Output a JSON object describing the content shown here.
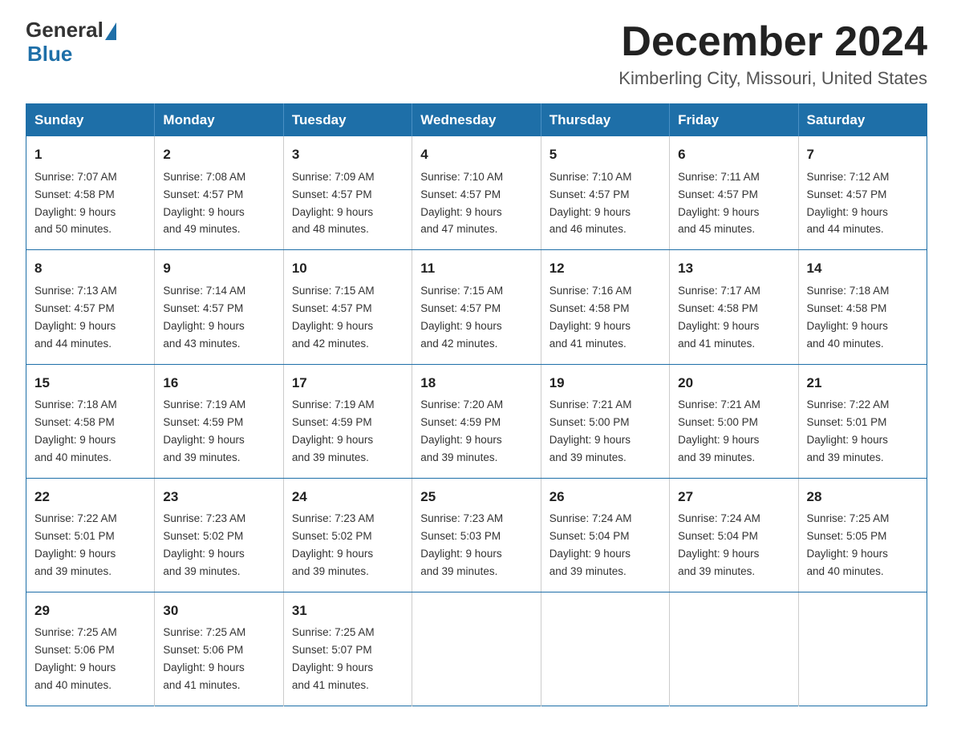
{
  "logo": {
    "general": "General",
    "blue": "Blue"
  },
  "title": "December 2024",
  "location": "Kimberling City, Missouri, United States",
  "days_of_week": [
    "Sunday",
    "Monday",
    "Tuesday",
    "Wednesday",
    "Thursday",
    "Friday",
    "Saturday"
  ],
  "weeks": [
    [
      {
        "day": "1",
        "sunrise": "7:07 AM",
        "sunset": "4:58 PM",
        "daylight": "9 hours and 50 minutes."
      },
      {
        "day": "2",
        "sunrise": "7:08 AM",
        "sunset": "4:57 PM",
        "daylight": "9 hours and 49 minutes."
      },
      {
        "day": "3",
        "sunrise": "7:09 AM",
        "sunset": "4:57 PM",
        "daylight": "9 hours and 48 minutes."
      },
      {
        "day": "4",
        "sunrise": "7:10 AM",
        "sunset": "4:57 PM",
        "daylight": "9 hours and 47 minutes."
      },
      {
        "day": "5",
        "sunrise": "7:10 AM",
        "sunset": "4:57 PM",
        "daylight": "9 hours and 46 minutes."
      },
      {
        "day": "6",
        "sunrise": "7:11 AM",
        "sunset": "4:57 PM",
        "daylight": "9 hours and 45 minutes."
      },
      {
        "day": "7",
        "sunrise": "7:12 AM",
        "sunset": "4:57 PM",
        "daylight": "9 hours and 44 minutes."
      }
    ],
    [
      {
        "day": "8",
        "sunrise": "7:13 AM",
        "sunset": "4:57 PM",
        "daylight": "9 hours and 44 minutes."
      },
      {
        "day": "9",
        "sunrise": "7:14 AM",
        "sunset": "4:57 PM",
        "daylight": "9 hours and 43 minutes."
      },
      {
        "day": "10",
        "sunrise": "7:15 AM",
        "sunset": "4:57 PM",
        "daylight": "9 hours and 42 minutes."
      },
      {
        "day": "11",
        "sunrise": "7:15 AM",
        "sunset": "4:57 PM",
        "daylight": "9 hours and 42 minutes."
      },
      {
        "day": "12",
        "sunrise": "7:16 AM",
        "sunset": "4:58 PM",
        "daylight": "9 hours and 41 minutes."
      },
      {
        "day": "13",
        "sunrise": "7:17 AM",
        "sunset": "4:58 PM",
        "daylight": "9 hours and 41 minutes."
      },
      {
        "day": "14",
        "sunrise": "7:18 AM",
        "sunset": "4:58 PM",
        "daylight": "9 hours and 40 minutes."
      }
    ],
    [
      {
        "day": "15",
        "sunrise": "7:18 AM",
        "sunset": "4:58 PM",
        "daylight": "9 hours and 40 minutes."
      },
      {
        "day": "16",
        "sunrise": "7:19 AM",
        "sunset": "4:59 PM",
        "daylight": "9 hours and 39 minutes."
      },
      {
        "day": "17",
        "sunrise": "7:19 AM",
        "sunset": "4:59 PM",
        "daylight": "9 hours and 39 minutes."
      },
      {
        "day": "18",
        "sunrise": "7:20 AM",
        "sunset": "4:59 PM",
        "daylight": "9 hours and 39 minutes."
      },
      {
        "day": "19",
        "sunrise": "7:21 AM",
        "sunset": "5:00 PM",
        "daylight": "9 hours and 39 minutes."
      },
      {
        "day": "20",
        "sunrise": "7:21 AM",
        "sunset": "5:00 PM",
        "daylight": "9 hours and 39 minutes."
      },
      {
        "day": "21",
        "sunrise": "7:22 AM",
        "sunset": "5:01 PM",
        "daylight": "9 hours and 39 minutes."
      }
    ],
    [
      {
        "day": "22",
        "sunrise": "7:22 AM",
        "sunset": "5:01 PM",
        "daylight": "9 hours and 39 minutes."
      },
      {
        "day": "23",
        "sunrise": "7:23 AM",
        "sunset": "5:02 PM",
        "daylight": "9 hours and 39 minutes."
      },
      {
        "day": "24",
        "sunrise": "7:23 AM",
        "sunset": "5:02 PM",
        "daylight": "9 hours and 39 minutes."
      },
      {
        "day": "25",
        "sunrise": "7:23 AM",
        "sunset": "5:03 PM",
        "daylight": "9 hours and 39 minutes."
      },
      {
        "day": "26",
        "sunrise": "7:24 AM",
        "sunset": "5:04 PM",
        "daylight": "9 hours and 39 minutes."
      },
      {
        "day": "27",
        "sunrise": "7:24 AM",
        "sunset": "5:04 PM",
        "daylight": "9 hours and 39 minutes."
      },
      {
        "day": "28",
        "sunrise": "7:25 AM",
        "sunset": "5:05 PM",
        "daylight": "9 hours and 40 minutes."
      }
    ],
    [
      {
        "day": "29",
        "sunrise": "7:25 AM",
        "sunset": "5:06 PM",
        "daylight": "9 hours and 40 minutes."
      },
      {
        "day": "30",
        "sunrise": "7:25 AM",
        "sunset": "5:06 PM",
        "daylight": "9 hours and 41 minutes."
      },
      {
        "day": "31",
        "sunrise": "7:25 AM",
        "sunset": "5:07 PM",
        "daylight": "9 hours and 41 minutes."
      },
      null,
      null,
      null,
      null
    ]
  ],
  "labels": {
    "sunrise": "Sunrise:",
    "sunset": "Sunset:",
    "daylight": "Daylight:"
  }
}
